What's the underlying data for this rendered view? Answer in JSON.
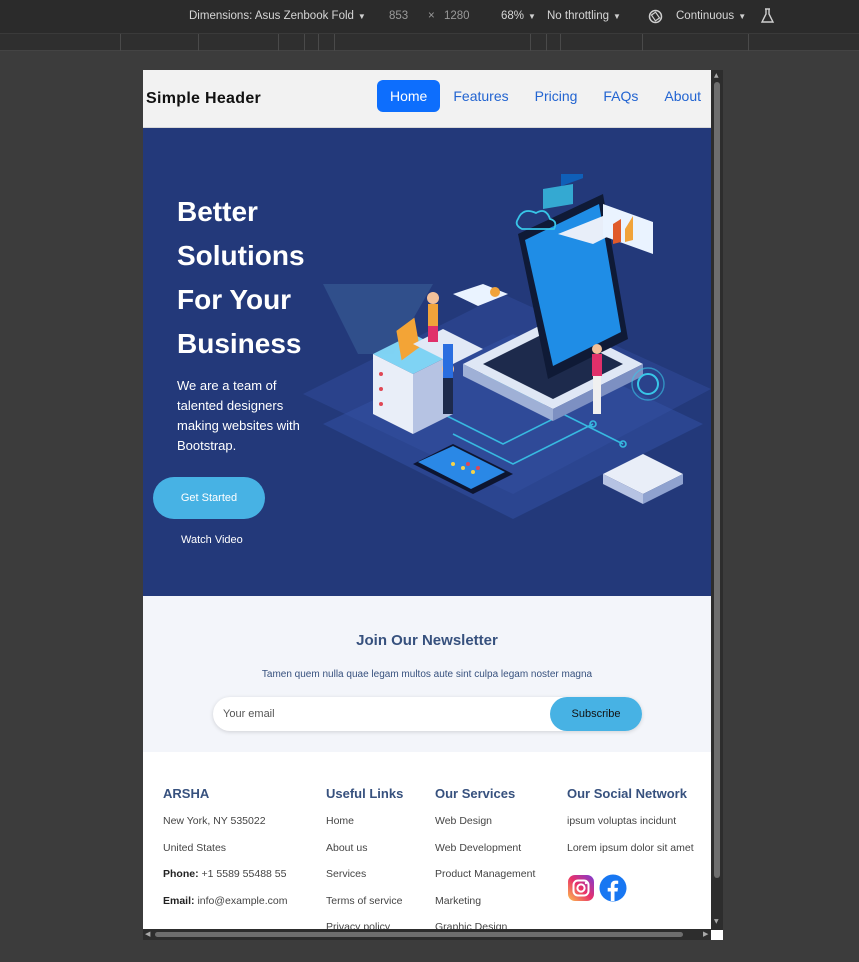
{
  "devtools": {
    "dimensions_label": "Dimensions: Asus Zenbook Fold",
    "width": "853",
    "times": "×",
    "height": "1280",
    "zoom": "68%",
    "throttling": "No throttling",
    "mode": "Continuous"
  },
  "header": {
    "brand": "Simple Header",
    "nav": [
      "Home",
      "Features",
      "Pricing",
      "FAQs",
      "About"
    ]
  },
  "hero": {
    "title": "Better Solutions For Your Business",
    "text": "We are a team of talented designers making websites with Bootstrap.",
    "cta": "Get Started",
    "video": "Watch Video"
  },
  "newsletter": {
    "title": "Join Our Newsletter",
    "subtitle": "Tamen quem nulla quae legam multos aute sint culpa legam noster magna",
    "placeholder": "Your email",
    "button": "Subscribe"
  },
  "footer": {
    "brand": {
      "title": "ARSHA",
      "address1": "New York, NY 535022",
      "address2": "United States",
      "phone_label": "Phone:",
      "phone": "+1 5589 55488 55",
      "email_label": "Email:",
      "email": "info@example.com"
    },
    "links": {
      "title": "Useful Links",
      "items": [
        "Home",
        "About us",
        "Services",
        "Terms of service",
        "Privacy policy"
      ]
    },
    "services": {
      "title": "Our Services",
      "items": [
        "Web Design",
        "Web Development",
        "Product Management",
        "Marketing",
        "Graphic Design"
      ]
    },
    "social": {
      "title": "Our Social Network",
      "line1": "ipsum voluptas incidunt",
      "line2": "Lorem ipsum dolor sit amet",
      "icons": [
        "instagram-icon",
        "facebook-icon"
      ]
    }
  },
  "colors": {
    "hero_bg": "#23397a",
    "accent": "#47b2e4",
    "nav_active": "#0d6efd",
    "heading": "#37517e"
  }
}
